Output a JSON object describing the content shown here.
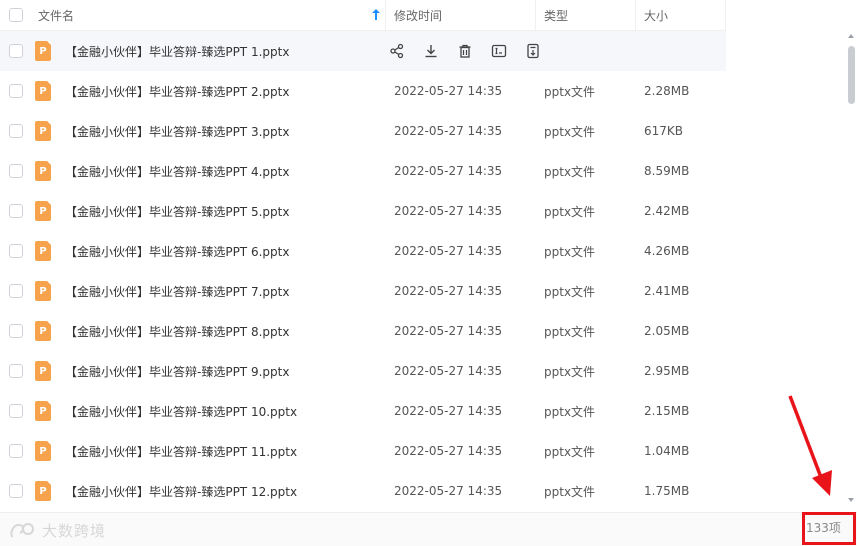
{
  "header": {
    "name_label": "文件名",
    "time_label": "修改时间",
    "type_label": "类型",
    "size_label": "大小",
    "sort_icon": "arrow-up-icon"
  },
  "rows": [
    {
      "name": "【金融小伙伴】毕业答辩-臻选PPT 1.pptx",
      "time": "",
      "type": "",
      "size": ""
    },
    {
      "name": "【金融小伙伴】毕业答辩-臻选PPT 2.pptx",
      "time": "2022-05-27 14:35",
      "type": "pptx文件",
      "size": "2.28MB"
    },
    {
      "name": "【金融小伙伴】毕业答辩-臻选PPT 3.pptx",
      "time": "2022-05-27 14:35",
      "type": "pptx文件",
      "size": "617KB"
    },
    {
      "name": "【金融小伙伴】毕业答辩-臻选PPT 4.pptx",
      "time": "2022-05-27 14:35",
      "type": "pptx文件",
      "size": "8.59MB"
    },
    {
      "name": "【金融小伙伴】毕业答辩-臻选PPT 5.pptx",
      "time": "2022-05-27 14:35",
      "type": "pptx文件",
      "size": "2.42MB"
    },
    {
      "name": "【金融小伙伴】毕业答辩-臻选PPT 6.pptx",
      "time": "2022-05-27 14:35",
      "type": "pptx文件",
      "size": "4.26MB"
    },
    {
      "name": "【金融小伙伴】毕业答辩-臻选PPT 7.pptx",
      "time": "2022-05-27 14:35",
      "type": "pptx文件",
      "size": "2.41MB"
    },
    {
      "name": "【金融小伙伴】毕业答辩-臻选PPT 8.pptx",
      "time": "2022-05-27 14:35",
      "type": "pptx文件",
      "size": "2.05MB"
    },
    {
      "name": "【金融小伙伴】毕业答辩-臻选PPT 9.pptx",
      "time": "2022-05-27 14:35",
      "type": "pptx文件",
      "size": "2.95MB"
    },
    {
      "name": "【金融小伙伴】毕业答辩-臻选PPT 10.pptx",
      "time": "2022-05-27 14:35",
      "type": "pptx文件",
      "size": "2.15MB"
    },
    {
      "name": "【金融小伙伴】毕业答辩-臻选PPT 11.pptx",
      "time": "2022-05-27 14:35",
      "type": "pptx文件",
      "size": "1.04MB"
    },
    {
      "name": "【金融小伙伴】毕业答辩-臻选PPT 12.pptx",
      "time": "2022-05-27 14:35",
      "type": "pptx文件",
      "size": "1.75MB"
    }
  ],
  "file_icon_letter": "P",
  "row_actions": [
    "share-icon",
    "download-icon",
    "delete-icon",
    "rename-icon",
    "move-icon"
  ],
  "footer": {
    "count": "133项",
    "watermark": "大数跨境"
  },
  "colors": {
    "accent": "#1e90ff",
    "file_icon": "#f6a34b",
    "highlight": "#e8141a"
  }
}
